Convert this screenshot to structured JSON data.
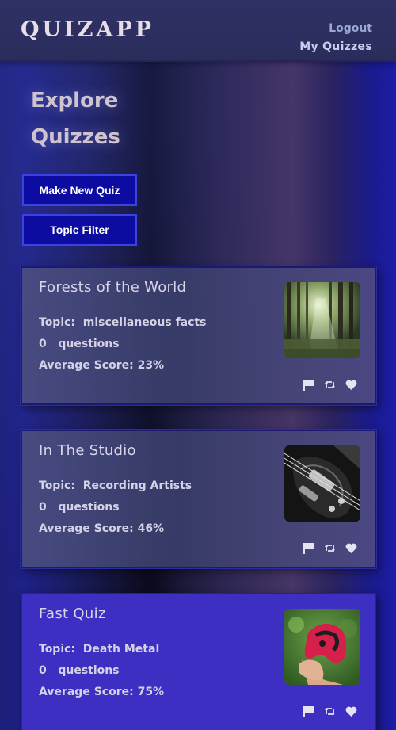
{
  "header": {
    "logo": "QUIZAPP",
    "logout_label": "Logout",
    "my_quizzes_label": "My Quizzes"
  },
  "page": {
    "title": "Explore Quizzes"
  },
  "actions": {
    "make_new_label": "Make New Quiz",
    "topic_filter_label": "Topic Filter"
  },
  "quizzes": [
    {
      "title": "Forests of the World",
      "topic_line": "Topic:  miscellaneous facts",
      "questions_line": "0   questions",
      "score_line": "Average Score: 23%",
      "image": "forest-photo"
    },
    {
      "title": "In The Studio",
      "topic_line": "Topic:  Recording Artists",
      "questions_line": "0   questions",
      "score_line": "Average Score: 46%",
      "image": "electric-guitar-photo"
    },
    {
      "title": "Fast Quiz",
      "topic_line": "Topic:  Death Metal",
      "questions_line": "0   questions",
      "score_line": "Average Score: 75%",
      "image": "game-controller-photo"
    }
  ],
  "card_icons": [
    "flag-icon",
    "retweet-icon",
    "heart-icon"
  ],
  "colors": {
    "button_bg": "#0c0ca0",
    "button_border": "#3c42e0",
    "active_card": "#3d2fc2"
  }
}
